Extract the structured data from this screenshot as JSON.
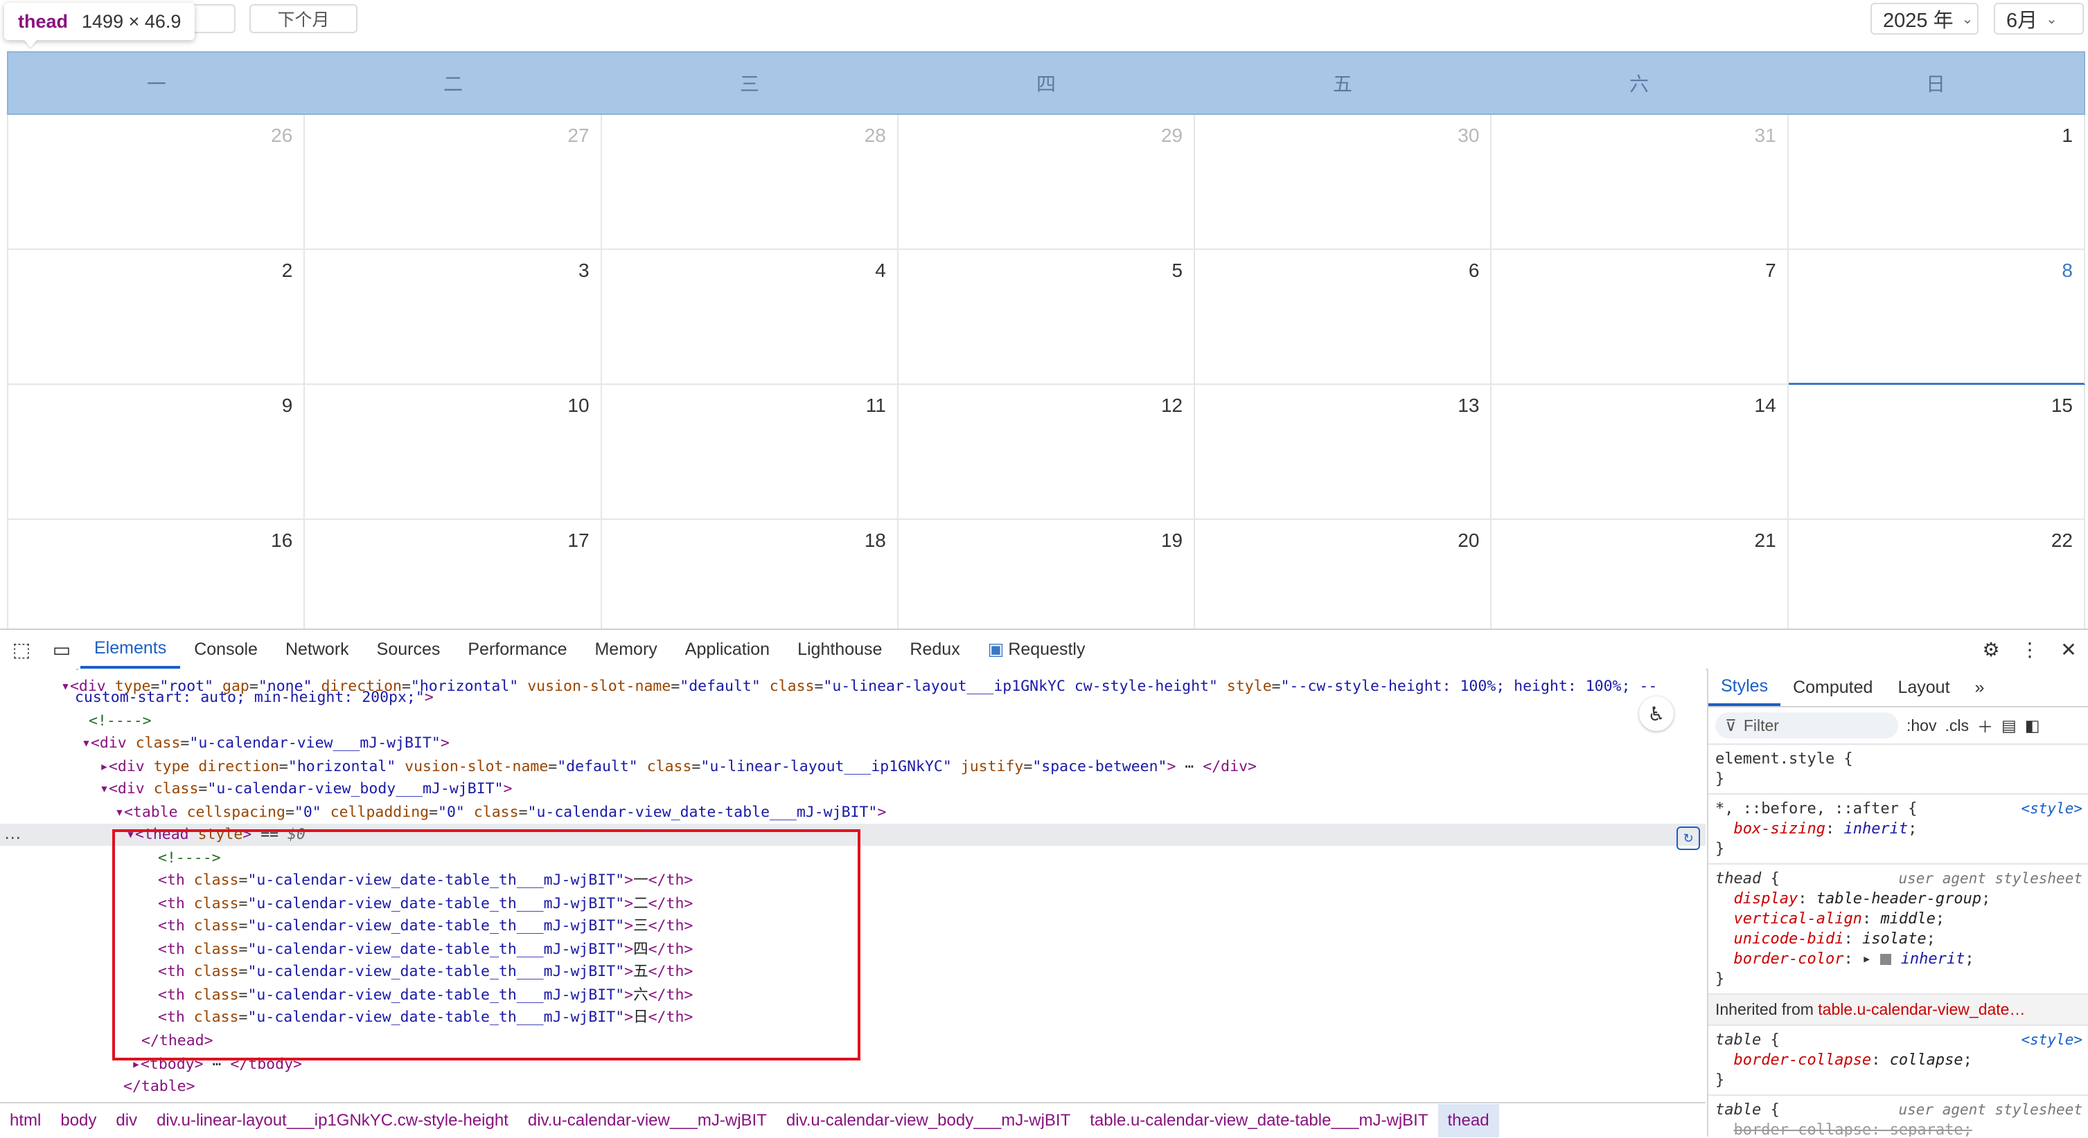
{
  "tooltip": {
    "tag": "thead",
    "dims": "1499 × 46.9"
  },
  "toolbar": {
    "prev_label": "",
    "next_label": "下个月",
    "year": "2025 年",
    "month": "6月"
  },
  "calendar": {
    "weekdays": [
      "一",
      "二",
      "三",
      "四",
      "五",
      "六",
      "日"
    ],
    "weeks": [
      [
        {
          "d": "26",
          "dim": true
        },
        {
          "d": "27",
          "dim": true
        },
        {
          "d": "28",
          "dim": true
        },
        {
          "d": "29",
          "dim": true
        },
        {
          "d": "30",
          "dim": true
        },
        {
          "d": "31",
          "dim": true
        },
        {
          "d": "1"
        }
      ],
      [
        {
          "d": "2"
        },
        {
          "d": "3"
        },
        {
          "d": "4"
        },
        {
          "d": "5"
        },
        {
          "d": "6"
        },
        {
          "d": "7"
        },
        {
          "d": "8",
          "today": true
        }
      ],
      [
        {
          "d": "9"
        },
        {
          "d": "10"
        },
        {
          "d": "11"
        },
        {
          "d": "12"
        },
        {
          "d": "13"
        },
        {
          "d": "14"
        },
        {
          "d": "15"
        }
      ],
      [
        {
          "d": "16"
        },
        {
          "d": "17"
        },
        {
          "d": "18"
        },
        {
          "d": "19"
        },
        {
          "d": "20"
        },
        {
          "d": "21"
        },
        {
          "d": "22"
        }
      ]
    ]
  },
  "devtools": {
    "tabs": [
      "Elements",
      "Console",
      "Network",
      "Sources",
      "Performance",
      "Memory",
      "Application",
      "Lighthouse",
      "Redux",
      "Requestly"
    ],
    "active_tab": "Elements",
    "dom_lines": [
      {
        "indent": "",
        "html": "<span class='tg'>▾&lt;div</span> <span class='an'>type</span>=<span class='av'>\"root\"</span> <span class='an'>gap</span>=<span class='av'>\"none\"</span> <span class='an'>direction</span>=<span class='av'>\"horizontal\"</span> <span class='an'>vusion-slot-name</span>=<span class='av'>\"default\"</span> <span class='an'>class</span>=<span class='av'>\"u-linear-layout___ip1GNkYC cw-style-height\"</span> <span class='an'>style</span>=<span class='av'>\"--cw-style-height: 100%; height: 100%; --</span>"
      },
      {
        "indent": "",
        "html": "<span class='av'>custom-start: auto; min-height: 200px;\"</span><span class='tg'>&gt;</span>"
      },
      {
        "indent": "",
        "html": "<span class='cm'>&lt;!----&gt;</span>"
      },
      {
        "indent": "",
        "html": "<span class='tg'>▾&lt;div</span> <span class='an'>class</span>=<span class='av'>\"u-calendar-view___mJ-wjBIT\"</span><span class='tg'>&gt;</span>"
      },
      {
        "indent": "",
        "html": "<span class='tg'>▸&lt;div</span> <span class='an'>type</span> <span class='an'>direction</span>=<span class='av'>\"horizontal\"</span> <span class='an'>vusion-slot-name</span>=<span class='av'>\"default\"</span> <span class='an'>class</span>=<span class='av'>\"u-linear-layout___ip1GNkYC\"</span> <span class='an'>justify</span>=<span class='av'>\"space-between\"</span><span class='tg'>&gt;</span> ⋯ <span class='tg'>&lt;/div&gt;</span>"
      },
      {
        "indent": "",
        "html": "<span class='tg'>▾&lt;div</span> <span class='an'>class</span>=<span class='av'>\"u-calendar-view_body___mJ-wjBIT\"</span><span class='tg'>&gt;</span>"
      },
      {
        "indent": "",
        "html": "<span class='tg'>▾&lt;table</span> <span class='an'>cellspacing</span>=<span class='av'>\"0\"</span> <span class='an'>cellpadding</span>=<span class='av'>\"0\"</span> <span class='an'>class</span>=<span class='av'>\"u-calendar-view_date-table___mJ-wjBIT\"</span><span class='tg'>&gt;</span>"
      },
      {
        "indent": "",
        "html": "<span class='tg'>▾&lt;thead</span> <span class='an'>style</span><span class='tg'>&gt;</span> <span class='tx'>== </span><span style='color:#666;font-style:italic'>$0</span>"
      },
      {
        "indent": "",
        "html": "<span class='cm'>&lt;!----&gt;</span>"
      },
      {
        "indent": "",
        "html": "<span class='tg'>&lt;th</span> <span class='an'>class</span>=<span class='av'>\"u-calendar-view_date-table_th___mJ-wjBIT\"</span><span class='tg'>&gt;</span><span class='tx'>一</span><span class='tg'>&lt;/th&gt;</span>"
      },
      {
        "indent": "",
        "html": "<span class='tg'>&lt;th</span> <span class='an'>class</span>=<span class='av'>\"u-calendar-view_date-table_th___mJ-wjBIT\"</span><span class='tg'>&gt;</span><span class='tx'>二</span><span class='tg'>&lt;/th&gt;</span>"
      },
      {
        "indent": "",
        "html": "<span class='tg'>&lt;th</span> <span class='an'>class</span>=<span class='av'>\"u-calendar-view_date-table_th___mJ-wjBIT\"</span><span class='tg'>&gt;</span><span class='tx'>三</span><span class='tg'>&lt;/th&gt;</span>"
      },
      {
        "indent": "",
        "html": "<span class='tg'>&lt;th</span> <span class='an'>class</span>=<span class='av'>\"u-calendar-view_date-table_th___mJ-wjBIT\"</span><span class='tg'>&gt;</span><span class='tx'>四</span><span class='tg'>&lt;/th&gt;</span>"
      },
      {
        "indent": "",
        "html": "<span class='tg'>&lt;th</span> <span class='an'>class</span>=<span class='av'>\"u-calendar-view_date-table_th___mJ-wjBIT\"</span><span class='tg'>&gt;</span><span class='tx'>五</span><span class='tg'>&lt;/th&gt;</span>"
      },
      {
        "indent": "",
        "html": "<span class='tg'>&lt;th</span> <span class='an'>class</span>=<span class='av'>\"u-calendar-view_date-table_th___mJ-wjBIT\"</span><span class='tg'>&gt;</span><span class='tx'>六</span><span class='tg'>&lt;/th&gt;</span>"
      },
      {
        "indent": "",
        "html": "<span class='tg'>&lt;th</span> <span class='an'>class</span>=<span class='av'>\"u-calendar-view_date-table_th___mJ-wjBIT\"</span><span class='tg'>&gt;</span><span class='tx'>日</span><span class='tg'>&lt;/th&gt;</span>"
      },
      {
        "indent": "",
        "html": "<span class='tg'>&lt;/thead&gt;</span>"
      },
      {
        "indent": "",
        "html": "<span class='tg'>▸&lt;tbody&gt;</span> ⋯ <span class='tg'>&lt;/tbody&gt;</span>"
      },
      {
        "indent": "",
        "html": "<span class='tg'>&lt;/table&gt;</span>"
      }
    ],
    "breadcrumbs": [
      "html",
      "body",
      "div",
      "div.u-linear-layout___ip1GNkYC.cw-style-height",
      "div.u-calendar-view___mJ-wjBIT",
      "div.u-calendar-view_body___mJ-wjBIT",
      "table.u-calendar-view_date-table___mJ-wjBIT",
      "thead"
    ],
    "styles_tabs": [
      "Styles",
      "Computed",
      "Layout"
    ],
    "filter_placeholder": "Filter",
    "filter_hov": ":hov",
    "filter_cls": ".cls",
    "inherited_from_label": "Inherited from",
    "inherited_from_link": "table.u-calendar-view_date…"
  }
}
